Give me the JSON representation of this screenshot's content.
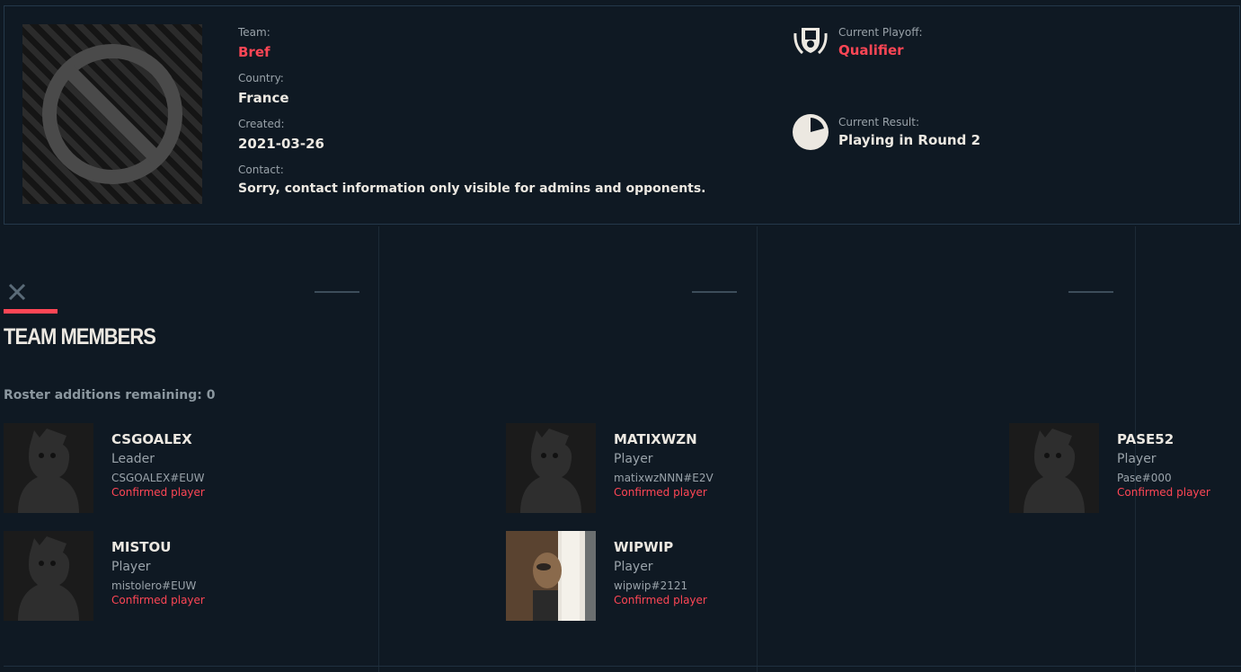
{
  "team": {
    "team_label": "Team:",
    "team_name": "Bref",
    "country_label": "Country:",
    "country": "France",
    "created_label": "Created:",
    "created": "2021-03-26",
    "contact_label": "Contact:",
    "contact": "Sorry, contact information only visible for admins and opponents."
  },
  "playoff": {
    "label": "Current Playoff:",
    "value": "Qualifier",
    "icon": "trophy-shield-icon"
  },
  "result": {
    "label": "Current Result:",
    "value": "Playing in Round 2",
    "icon": "pie-progress-icon"
  },
  "section": {
    "title": "TEAM MEMBERS",
    "roster_note": "Roster additions remaining: 0"
  },
  "members": [
    {
      "name": "CSGOALEX",
      "role": "Leader",
      "tag": "CSGOALEX#EUW",
      "status": "Confirmed player",
      "avatar": "default-silhouette"
    },
    {
      "name": "MATIXWZN",
      "role": "Player",
      "tag": "matixwzNNN#E2V",
      "status": "Confirmed player",
      "avatar": "default-silhouette"
    },
    {
      "name": "PASE52",
      "role": "Player",
      "tag": "Pase#000",
      "status": "Confirmed player",
      "avatar": "default-silhouette"
    },
    {
      "name": "MISTOU",
      "role": "Player",
      "tag": "mistolero#EUW",
      "status": "Confirmed player",
      "avatar": "default-silhouette"
    },
    {
      "name": "WIPWIP",
      "role": "Player",
      "tag": "wipwip#2121",
      "status": "Confirmed player",
      "avatar": "photo"
    }
  ],
  "colors": {
    "background": "#0f1923",
    "accent": "#ff4655",
    "text": "#ece8e1",
    "muted": "#9aa3aa"
  }
}
